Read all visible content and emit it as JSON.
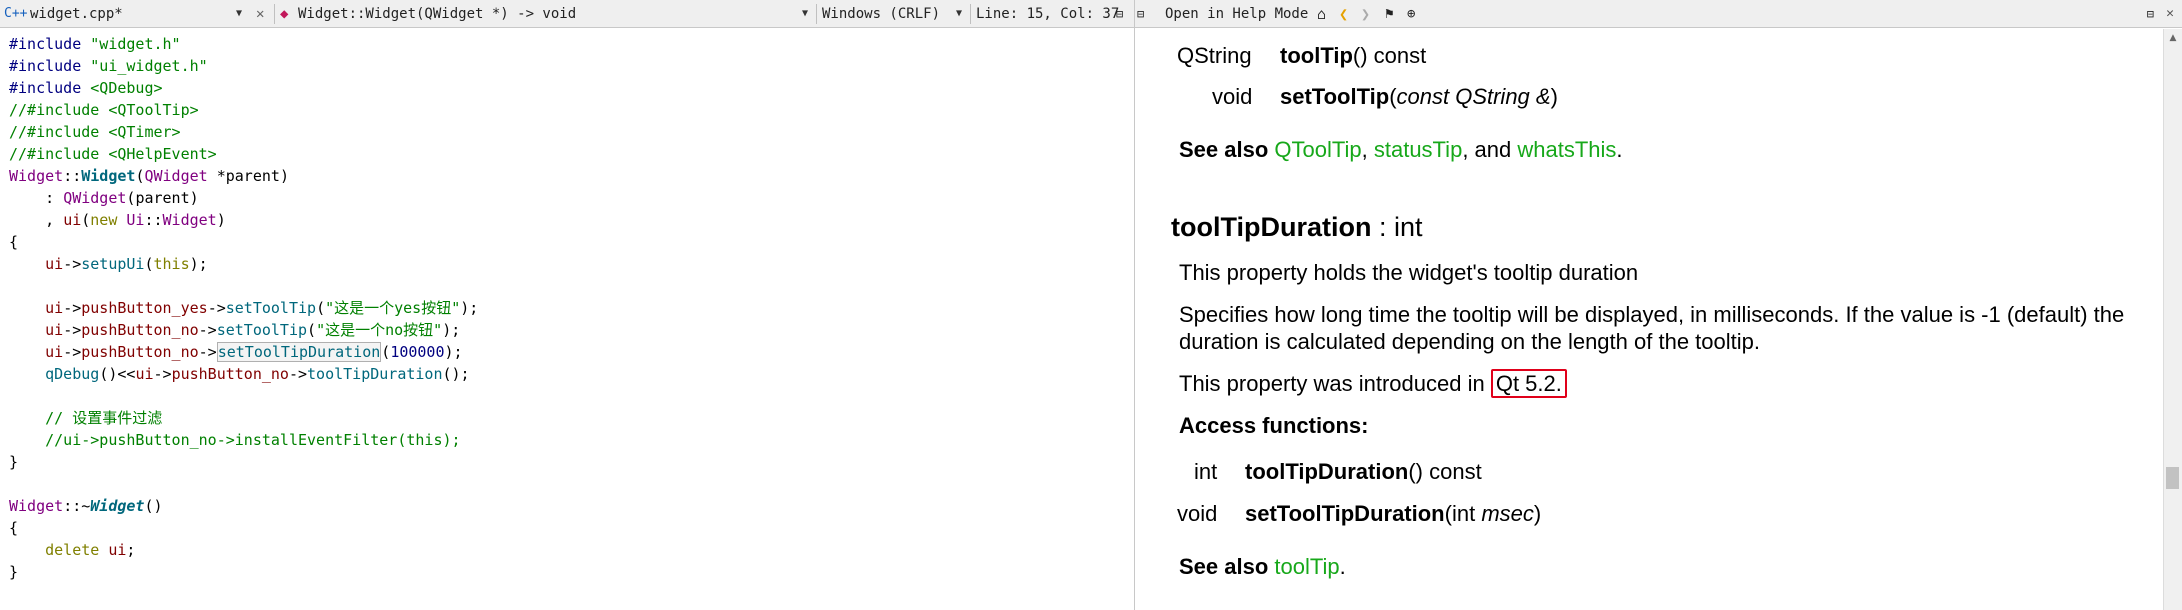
{
  "editor": {
    "file_name": "widget.cpp*",
    "function_combo": "Widget::Widget(QWidget *) -> void",
    "line_ending": "Windows (CRLF)",
    "cursor_position": "Line: 15, Col: 37",
    "lines": {
      "l1a": "#include",
      "l1b": " \"widget.h\"",
      "l2a": "#include",
      "l2b": " \"ui_widget.h\"",
      "l3a": "#include",
      "l3b": " <QDebug>",
      "l4": "//#include <QToolTip>",
      "l5": "//#include <QTimer>",
      "l6": "//#include <QHelpEvent>",
      "l7a": "Widget",
      "l7b": "::",
      "l7c": "Widget",
      "l7d": "(",
      "l7e": "QWidget",
      "l7f": " *",
      "l7g": "parent",
      "l7h": ")",
      "l8a": "    : ",
      "l8b": "QWidget",
      "l8c": "(",
      "l8d": "parent",
      "l8e": ")",
      "l9a": "    , ",
      "l9b": "ui",
      "l9c": "(",
      "l9d": "new",
      "l9e": " Ui",
      "l9f": "::",
      "l9g": "Widget",
      "l9h": ")",
      "l10": "{",
      "l11a": "    ui",
      "l11b": "->",
      "l11c": "setupUi",
      "l11d": "(",
      "l11e": "this",
      "l11f": ");",
      "l13a": "    ui",
      "l13b": "->",
      "l13c": "pushButton_yes",
      "l13d": "->",
      "l13e": "setToolTip",
      "l13f": "(",
      "l13g": "\"这是一个yes按钮\"",
      "l13h": ");",
      "l14a": "    ui",
      "l14b": "->",
      "l14c": "pushButton_no",
      "l14d": "->",
      "l14e": "setToolTip",
      "l14f": "(",
      "l14g": "\"这是一个no按钮\"",
      "l14h": ");",
      "l15a": "    ui",
      "l15b": "->",
      "l15c": "pushButton_no",
      "l15d": "->",
      "l15e": "setToolTipDuration",
      "l15f": "(",
      "l15g": "100000",
      "l15h": ");",
      "l16a": "    qDebug",
      "l16b": "()<<",
      "l16c": "ui",
      "l16d": "->",
      "l16e": "pushButton_no",
      "l16f": "->",
      "l16g": "toolTipDuration",
      "l16h": "();",
      "l18": "    // 设置事件过滤",
      "l19": "    //ui->pushButton_no->installEventFilter(this);",
      "l20": "}",
      "l22a": "Widget",
      "l22b": "::~",
      "l22c": "Widget",
      "l22d": "()",
      "l23": "{",
      "l24a": "    delete",
      "l24b": " ui",
      "l24c": ";",
      "l25": "}"
    }
  },
  "help": {
    "toolbar_label": "Open in Help Mode",
    "sig1_type": "QString",
    "sig1_name": "toolTip",
    "sig1_rest": "() const",
    "sig2_type": "void",
    "sig2_name": "setToolTip",
    "sig2_paren_open": "(",
    "sig2_arg": "const QString &",
    "sig2_paren_close": ")",
    "see_also_label": "See also",
    "see_also_links": [
      "QToolTip",
      "statusTip",
      "whatsThis"
    ],
    "sep_comma": ", ",
    "sep_and": ", and ",
    "period": ".",
    "prop_name": "toolTipDuration",
    "prop_type": " : int",
    "desc1": "This property holds the widget's tooltip duration",
    "desc2a": "Specifies how long time the tooltip will be displayed, in milliseconds. If the value is -1 (default) the",
    "desc2b": "duration is calculated depending on the length of the tooltip.",
    "intro_text": "This property was introduced in ",
    "intro_version": "Qt 5.2.",
    "access_label": "Access functions:",
    "af1_type": "int",
    "af1_name": "toolTipDuration",
    "af1_rest": "() const",
    "af2_type": "void",
    "af2_name": "setToolTipDuration",
    "af2_open": "(int ",
    "af2_arg": "msec",
    "af2_close": ")",
    "see_also2_link": "toolTip"
  },
  "colors": {
    "link": "#17a81a",
    "highlight_box": "#e0001a"
  }
}
